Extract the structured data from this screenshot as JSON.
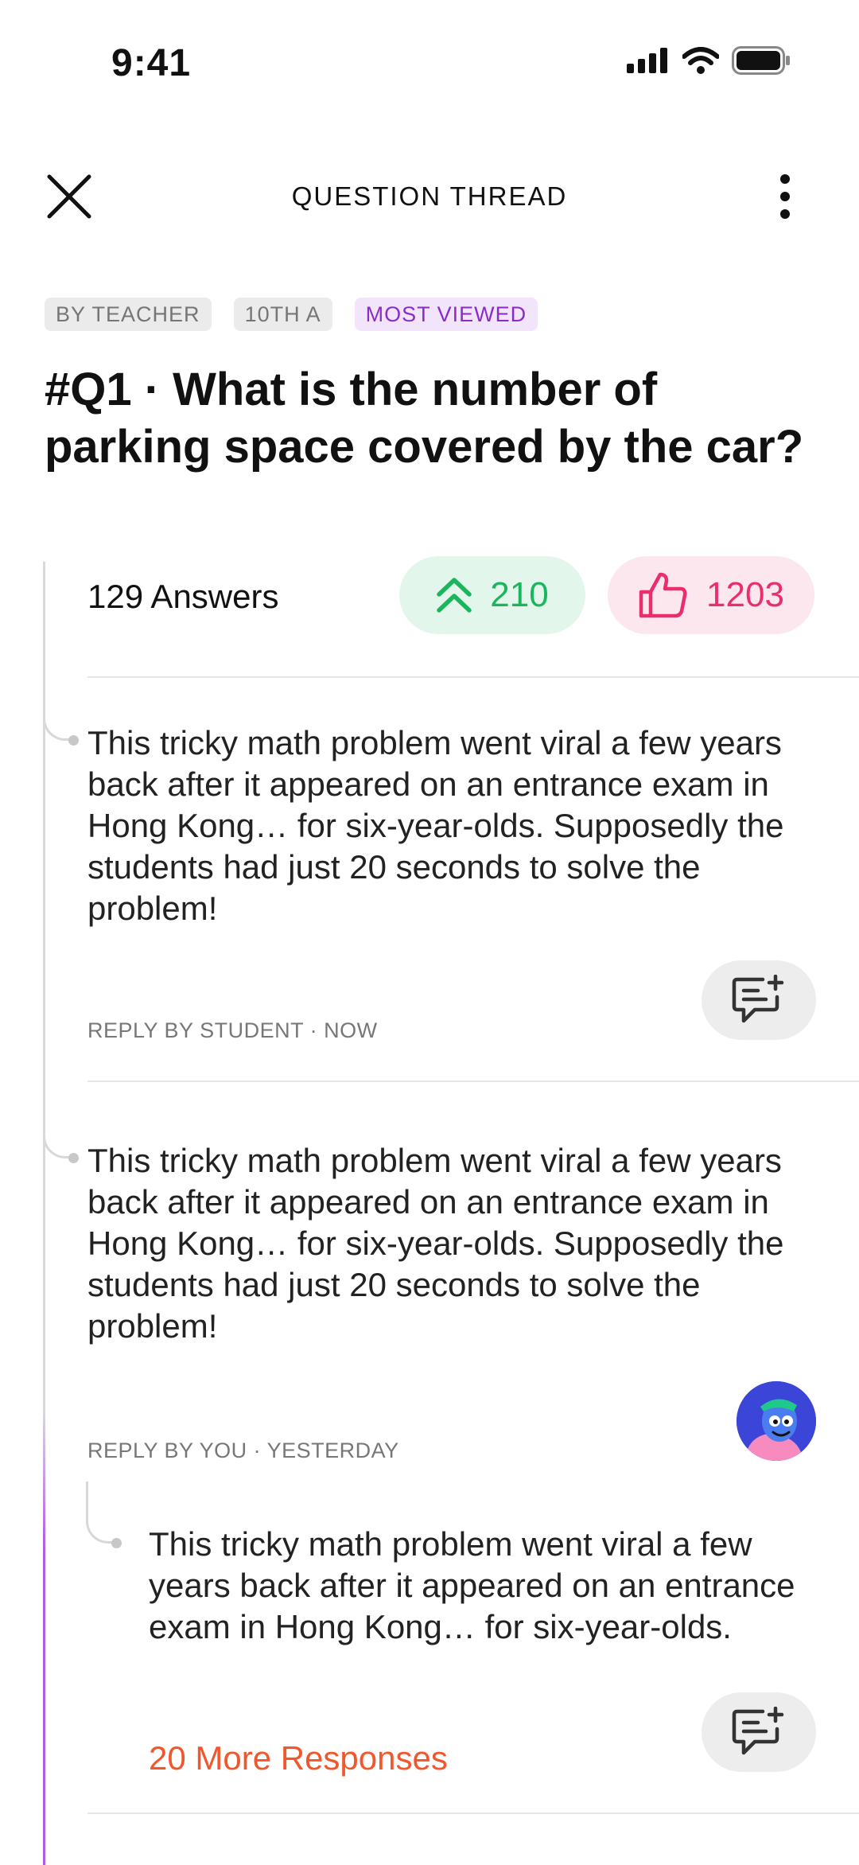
{
  "status_bar": {
    "time": "9:41"
  },
  "header": {
    "title": "QUESTION THREAD"
  },
  "tags": [
    "BY TEACHER",
    "10TH A",
    "MOST VIEWED"
  ],
  "question": {
    "text": "#Q1 · What is the number of parking space covered by the car?"
  },
  "stats": {
    "answers": "129 Answers",
    "upvotes": "210",
    "likes": "1203"
  },
  "answers": [
    {
      "text": "This tricky math problem went viral a few years back after it appeared on an entrance exam in Hong Kong… for six-year-olds. Supposedly the students had just 20 seconds to solve the problem!",
      "meta": "REPLY BY STUDENT · NOW"
    },
    {
      "text": "This tricky math problem went viral a few years back after it appeared on an entrance exam in Hong Kong… for six-year-olds. Supposedly the students had just 20 seconds to solve the problem!",
      "meta": "REPLY BY YOU · YESTERDAY",
      "reply": {
        "text": "This tricky math problem went viral a few years back after it appeared on an entrance exam in Hong Kong… for six-year-olds.",
        "more": "20 More Responses"
      }
    }
  ],
  "icons": {
    "close": "close-icon",
    "more": "more-vertical-icon",
    "upvote": "double-chevron-up-icon",
    "like": "thumbs-up-icon",
    "reply": "reply-message-icon"
  },
  "colors": {
    "upvote": "#1bb55c",
    "like": "#ea2d6f",
    "tag_viewed": "#8a2cc8",
    "more_responses": "#f2572c",
    "thread_accent": "#b35be6"
  }
}
